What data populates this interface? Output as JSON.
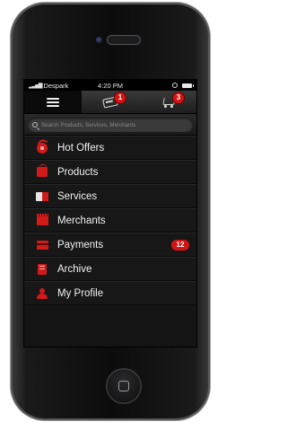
{
  "status_bar": {
    "carrier": "Despark",
    "time": "4:20 PM"
  },
  "toolbar": {
    "tabs": [
      {
        "name": "menu",
        "icon": "hamburger-icon"
      },
      {
        "name": "offers",
        "icon": "gift-card-icon",
        "badge": "1"
      },
      {
        "name": "cart",
        "icon": "shopping-cart-icon",
        "badge": "3"
      }
    ]
  },
  "search": {
    "placeholder": "Search Products, Services, Merchants",
    "value": ""
  },
  "menu": {
    "items": [
      {
        "label": "Hot Offers",
        "icon": "hot-offers-icon"
      },
      {
        "label": "Products",
        "icon": "products-bag-icon"
      },
      {
        "label": "Services",
        "icon": "services-icon"
      },
      {
        "label": "Merchants",
        "icon": "merchants-store-icon"
      },
      {
        "label": "Payments",
        "icon": "payments-wallet-icon",
        "badge": "12"
      },
      {
        "label": "Archive",
        "icon": "archive-icon"
      },
      {
        "label": "My Profile",
        "icon": "profile-icon"
      }
    ]
  },
  "colors": {
    "accent": "#d41414",
    "background": "#141414",
    "text": "#f2f2f2"
  }
}
